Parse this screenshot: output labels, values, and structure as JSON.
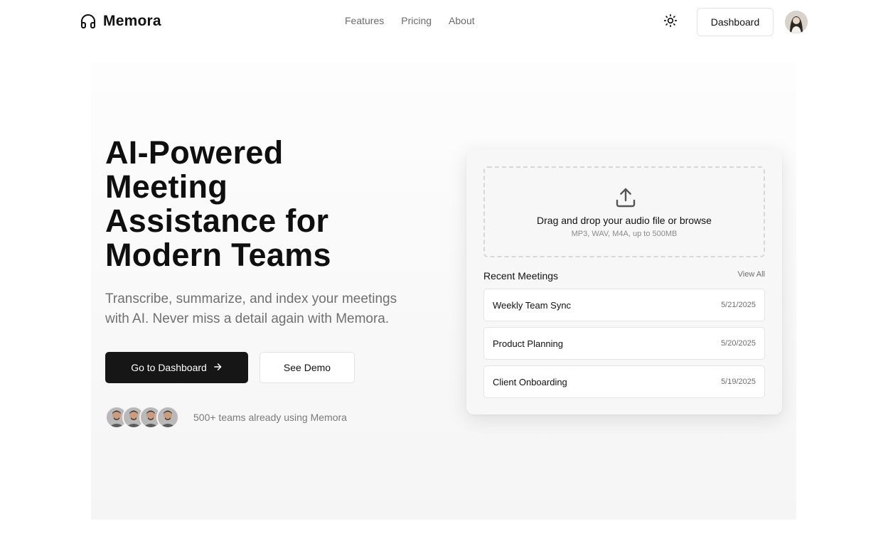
{
  "header": {
    "brand": "Memora",
    "nav": [
      "Features",
      "Pricing",
      "About"
    ],
    "dashboard_label": "Dashboard"
  },
  "hero": {
    "headline_lines": [
      "AI-Powered",
      "Meeting",
      "Assistance for",
      "Modern Teams"
    ],
    "subtext": "Transcribe, summarize, and index your meetings with AI. Never miss a detail again with Memora.",
    "primary_cta": "Go to Dashboard",
    "secondary_cta": "See Demo",
    "social_proof": "500+ teams already using Memora"
  },
  "upload": {
    "title": "Drag and drop your audio file or browse",
    "hint": "MP3, WAV, M4A, up to 500MB"
  },
  "recent": {
    "title": "Recent Meetings",
    "view_all": "View All",
    "meetings": [
      {
        "name": "Weekly Team Sync",
        "date": "5/21/2025"
      },
      {
        "name": "Product Planning",
        "date": "5/20/2025"
      },
      {
        "name": "Client Onboarding",
        "date": "5/19/2025"
      }
    ]
  },
  "icons": {
    "brand": "headphones-icon",
    "theme": "sun-icon",
    "cta_arrow": "arrow-right-icon",
    "upload": "upload-icon"
  },
  "colors": {
    "primary_button": "#161616",
    "text": "#111111",
    "muted": "#707070"
  }
}
